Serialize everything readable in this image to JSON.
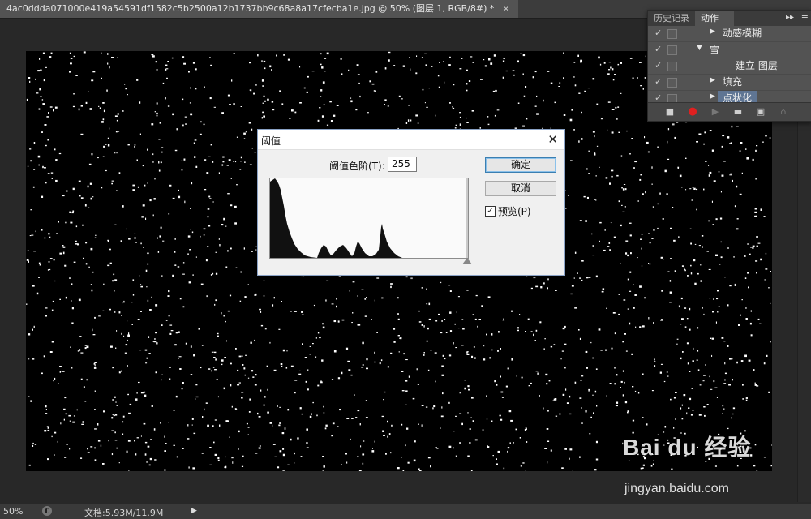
{
  "document_tab": {
    "title": "4ac0ddda071000e419a54591df1582c5b2500a12b1737bb9c68a8a17cfecba1e.jpg @ 50% (图层 1, RGB/8#) *",
    "close": "×"
  },
  "status_bar": {
    "zoom": "50%",
    "doc_size": "文档:5.93M/11.9M",
    "arrow": "▶"
  },
  "actions_panel": {
    "tabs": [
      "历史记录",
      "动作"
    ],
    "active_tab": "动作",
    "collapse_glyph": "▸▸",
    "menu_glyph": "≡",
    "rows": [
      {
        "label": "动感模糊",
        "indent": 2,
        "expanded": false,
        "selected": false
      },
      {
        "label": "雪",
        "indent": 1,
        "expanded": true,
        "selected": false
      },
      {
        "label": "建立 图层",
        "indent": 3,
        "expanded": null,
        "selected": false
      },
      {
        "label": "填充",
        "indent": 2,
        "expanded": false,
        "selected": false
      },
      {
        "label": "点状化",
        "indent": 2,
        "expanded": false,
        "selected": true
      }
    ],
    "check_glyph": "✓",
    "toolbar_icons": [
      "stop-icon",
      "record-icon",
      "play-icon",
      "folder-icon",
      "new-action-icon",
      "trash-icon"
    ]
  },
  "dialog": {
    "title": "阈值",
    "close": "✕",
    "level_label": "阈值色阶(T):",
    "level_value": "255",
    "ok_label": "确定",
    "cancel_label": "取消",
    "preview_label": "预览(P)",
    "preview_checked": true,
    "preview_check_glyph": "✓"
  },
  "watermark": {
    "logo": "Bai du 经验",
    "url": "jingyan.baidu.com"
  },
  "colors": {
    "panel_bg": "#535353",
    "selection": "#5f7593",
    "record_red": "#e02020",
    "dialog_bg": "#f0f0f0"
  }
}
